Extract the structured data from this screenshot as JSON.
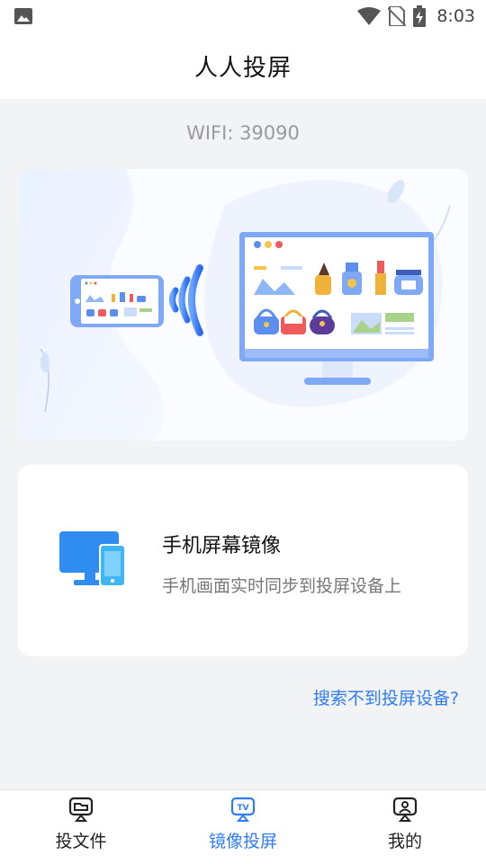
{
  "status_bar": {
    "time": "8:03",
    "icons": [
      "image-notification-icon",
      "wifi-icon",
      "no-sim-icon",
      "battery-charging-icon"
    ]
  },
  "header": {
    "title": "人人投屏"
  },
  "wifi": {
    "label": "WIFI: 39090"
  },
  "mirror_card": {
    "title": "手机屏幕镜像",
    "description": "手机画面实时同步到投屏设备上",
    "icon": "monitor-phone-icon"
  },
  "help_link": {
    "label": "搜索不到投屏设备?"
  },
  "bottom_nav": {
    "items": [
      {
        "label": "投文件",
        "icon": "cast-file-icon",
        "active": false
      },
      {
        "label": "镜像投屏",
        "icon": "tv-mirror-icon",
        "active": true
      },
      {
        "label": "我的",
        "icon": "profile-icon",
        "active": false
      }
    ]
  },
  "colors": {
    "accent": "#2f7cf6",
    "background": "#f2f3f5",
    "card": "#ffffff"
  }
}
